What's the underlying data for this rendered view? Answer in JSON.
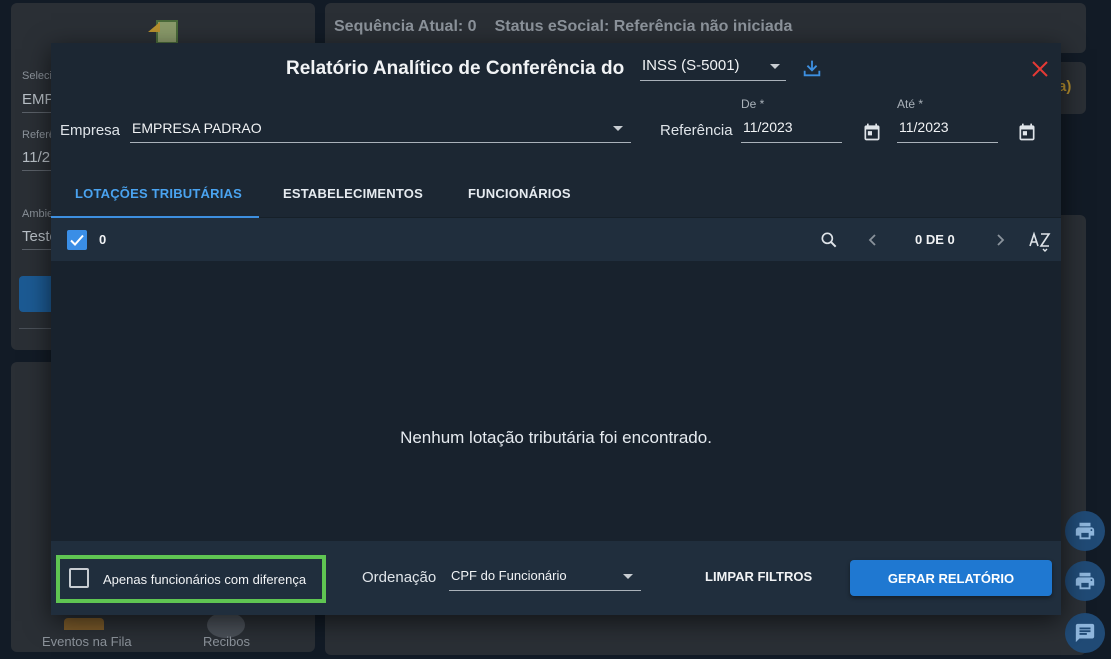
{
  "background": {
    "status": {
      "sequence": "Sequência Atual: 0",
      "esocial": "Status eSocial: Referência não iniciada"
    },
    "trail_text": "a)",
    "left_fields": [
      {
        "label": "Seleci",
        "value": "EMP"
      },
      {
        "label": "Referê",
        "value": "11/2"
      },
      {
        "label": "Ambie",
        "value": "Teste"
      }
    ],
    "bottom_items": [
      "Eventos na Fila",
      "Recibos"
    ]
  },
  "modal": {
    "title": "Relatório Analítico de Conferência do",
    "report_type": "INSS (S-5001)",
    "empresa": {
      "label": "Empresa",
      "value": "EMPRESA PADRAO"
    },
    "referencia": {
      "label": "Referência",
      "de_label": "De *",
      "de_value": "11/2023",
      "ate_label": "Até *",
      "ate_value": "11/2023"
    },
    "tabs": [
      {
        "label": "LOTAÇÕES TRIBUTÁRIAS",
        "active": true
      },
      {
        "label": "ESTABELECIMENTOS",
        "active": false
      },
      {
        "label": "FUNCIONÁRIOS",
        "active": false
      }
    ],
    "toolbar": {
      "selected_count": "0",
      "pager": "0 DE 0"
    },
    "empty_message": "Nenhum lotação tributária foi encontrado.",
    "footer": {
      "only_diff_label": "Apenas funcionários com diferença",
      "ordering_label": "Ordenação",
      "ordering_value": "CPF do Funcionário",
      "clear_label": "LIMPAR FILTROS",
      "generate_label": "GERAR RELATÓRIO"
    }
  },
  "colors": {
    "accent": "#1f78d1",
    "tab_active": "#4aa3f0",
    "close": "#e53935",
    "highlight_box": "#5fc552"
  },
  "icons": [
    "download-icon",
    "close-icon",
    "calendar-icon",
    "search-icon",
    "chevron-left-icon",
    "chevron-right-icon",
    "sort-az-icon",
    "print-icon",
    "chat-icon"
  ]
}
